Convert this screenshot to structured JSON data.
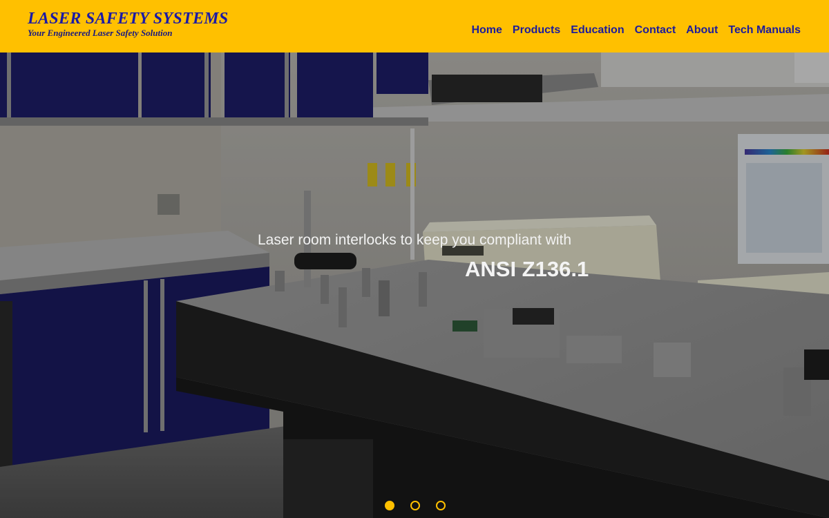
{
  "brand": {
    "title": "LASER SAFETY SYSTEMS",
    "tagline": "Your Engineered Laser Safety Solution"
  },
  "nav": {
    "items": [
      "Home",
      "Products",
      "Education",
      "Contact",
      "About",
      "Tech Manuals"
    ]
  },
  "hero": {
    "subtitle": "Laser room interlocks to keep you compliant with",
    "title": "ANSI Z136.1",
    "image_icon": "laser-lab-scene",
    "slides_total": 3,
    "active_slide": 1
  },
  "colors": {
    "header_bg": "#ffc000",
    "brand_text": "#1a1aa6",
    "nav_text": "#1c1c9c",
    "dot_accent": "#ffc000"
  }
}
